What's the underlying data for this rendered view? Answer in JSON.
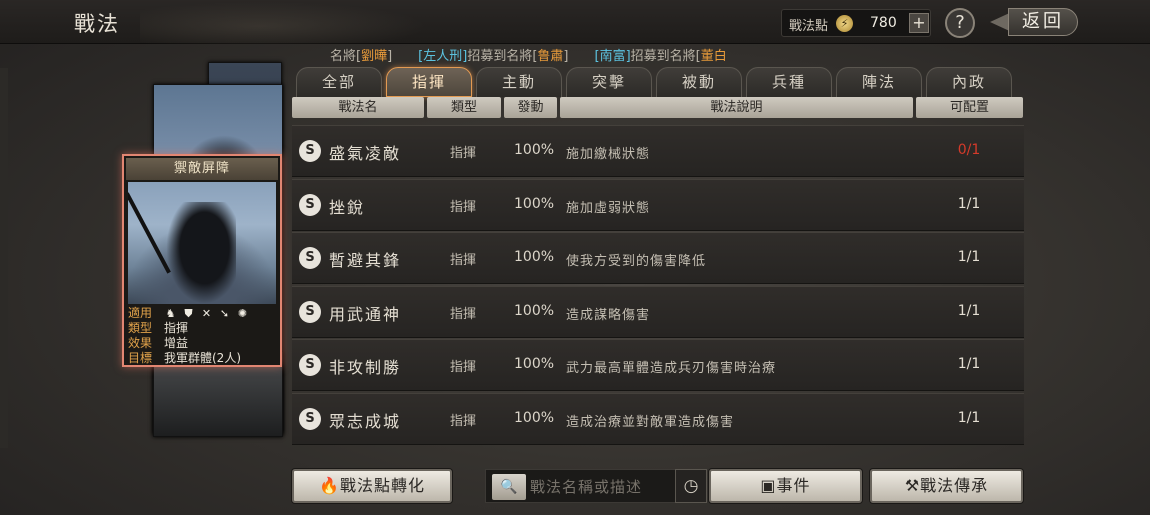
{
  "header": {
    "title": "戰法",
    "points_label": "戰法點",
    "points_value": "780",
    "add_icon": "+",
    "help_icon": "?",
    "back_label": "返回"
  },
  "ticker": [
    {
      "parts": [
        {
          "t": "名將[",
          "c": "white"
        },
        {
          "t": "劉曄",
          "c": "orange"
        },
        {
          "t": "]",
          "c": "white"
        }
      ]
    },
    {
      "parts": [
        {
          "t": "[左人刑]",
          "c": "cyan"
        },
        {
          "t": "招募到名將[",
          "c": "white"
        },
        {
          "t": "鲁肅",
          "c": "orange"
        },
        {
          "t": "]",
          "c": "white"
        }
      ]
    },
    {
      "parts": [
        {
          "t": "[南富]",
          "c": "cyan"
        },
        {
          "t": "招募到名將[",
          "c": "white"
        },
        {
          "t": "董白",
          "c": "orange"
        }
      ]
    }
  ],
  "card": {
    "name": "禦敵屏障",
    "applies_label": "適用",
    "type_label": "類型",
    "type_value": "指揮",
    "effect_label": "效果",
    "effect_value": "增益",
    "target_label": "目標",
    "target_value": "我軍群體(2人)"
  },
  "tabs": [
    "全部",
    "指揮",
    "主動",
    "突擊",
    "被動",
    "兵種",
    "陣法",
    "內政"
  ],
  "active_tab": 1,
  "columns": {
    "name": "戰法名",
    "type": "類型",
    "rate": "發動",
    "desc": "戰法說明",
    "count": "可配置"
  },
  "tactics": [
    {
      "grade": "S",
      "name": "盛氣凌敵",
      "type": "指揮",
      "rate": "100%",
      "desc": "施加繳械狀態",
      "count": "0/1",
      "count_red": true
    },
    {
      "grade": "S",
      "name": "挫銳",
      "type": "指揮",
      "rate": "100%",
      "desc": "施加虛弱狀態",
      "count": "1/1",
      "count_red": false
    },
    {
      "grade": "S",
      "name": "暫避其鋒",
      "type": "指揮",
      "rate": "100%",
      "desc": "使我方受到的傷害降低",
      "count": "1/1",
      "count_red": false
    },
    {
      "grade": "S",
      "name": "用武通神",
      "type": "指揮",
      "rate": "100%",
      "desc": "造成謀略傷害",
      "count": "1/1",
      "count_red": false
    },
    {
      "grade": "S",
      "name": "非攻制勝",
      "type": "指揮",
      "rate": "100%",
      "desc": "武力最高單體造成兵刃傷害時治療",
      "count": "1/1",
      "count_red": false
    },
    {
      "grade": "S",
      "name": "眾志成城",
      "type": "指揮",
      "rate": "100%",
      "desc": "造成治療並對敵軍造成傷害",
      "count": "1/1",
      "count_red": false
    }
  ],
  "footer": {
    "convert_label": "戰法點轉化",
    "search_placeholder": "戰法名稱或描述",
    "event_label": "事件",
    "inherit_label": "戰法傳承"
  },
  "colors": {
    "accent": "#e28672",
    "active_tab_border": "#e39a52",
    "count_red": "#d43a2a",
    "ticker_cyan": "#5cc3e0",
    "ticker_orange": "#e79a3a"
  }
}
